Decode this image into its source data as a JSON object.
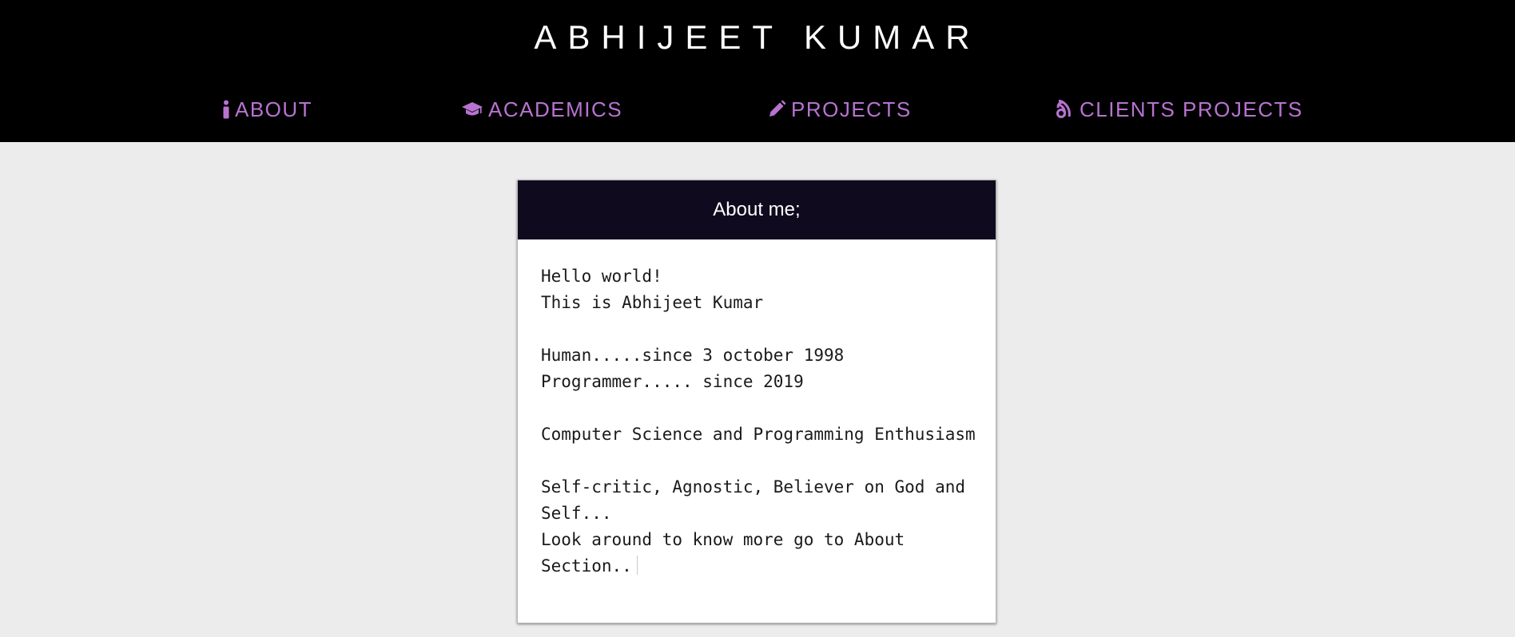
{
  "header": {
    "title": "ABHIJEET KUMAR"
  },
  "nav": {
    "items": [
      {
        "label": "ABOUT",
        "icon": "info-icon"
      },
      {
        "label": "ACADEMICS",
        "icon": "graduation-cap-icon"
      },
      {
        "label": "PROJECTS",
        "icon": "pencil-icon"
      },
      {
        "label": "CLIENTS PROJECTS",
        "icon": "blog-feed-icon"
      }
    ]
  },
  "card": {
    "title": "About me;",
    "lines": [
      "Hello world!",
      "This is Abhijeet Kumar",
      "",
      "Human.....since 3 october 1998",
      "Programmer..... since 2019",
      "",
      "Computer Science and Programming Enthusiasm",
      "",
      "Self-critic, Agnostic, Believer on God and",
      "Self...",
      "Look around to know more go to About",
      "Section.."
    ]
  },
  "colors": {
    "header_bg": "#000000",
    "nav_text": "#b873d1",
    "page_bg": "#ececec",
    "card_header_bg": "#0f0a1e",
    "card_bg": "#ffffff"
  }
}
